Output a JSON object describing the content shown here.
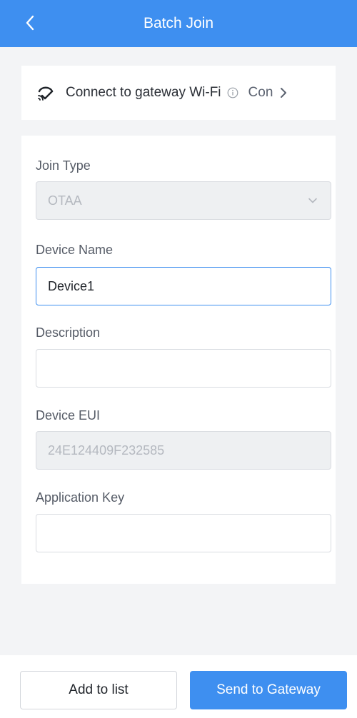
{
  "header": {
    "title": "Batch Join"
  },
  "wifi_card": {
    "text": "Connect to gateway Wi-Fi",
    "status": "Con"
  },
  "form": {
    "join_type": {
      "label": "Join Type",
      "value": "OTAA"
    },
    "device_name": {
      "label": "Device Name",
      "value": "Device1"
    },
    "description": {
      "label": "Description",
      "value": ""
    },
    "device_eui": {
      "label": "Device EUI",
      "value": "24E124409F232585"
    },
    "application_key": {
      "label": "Application Key",
      "value": ""
    }
  },
  "footer": {
    "add_label": "Add to list",
    "send_label": "Send to Gateway"
  },
  "colors": {
    "accent": "#3e8ff0",
    "background": "#f3f4f6"
  },
  "icons": [
    "back-arrow-icon",
    "gateway-wifi-icon",
    "info-icon",
    "chevron-right-icon",
    "chevron-down-icon"
  ]
}
